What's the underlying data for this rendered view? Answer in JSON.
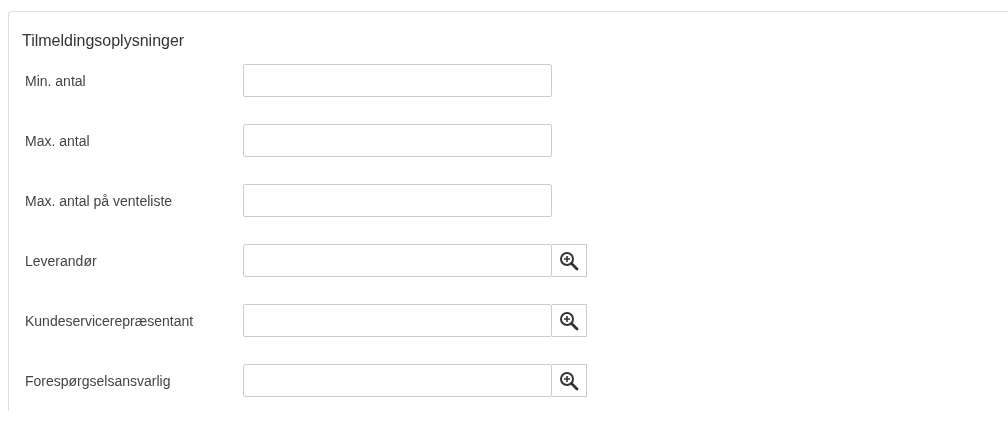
{
  "panel": {
    "title": "Tilmeldingsoplysninger"
  },
  "fields": [
    {
      "label": "Min. antal",
      "kind": "text"
    },
    {
      "label": "Max. antal",
      "kind": "text"
    },
    {
      "label": "Max. antal på venteliste",
      "kind": "text"
    },
    {
      "label": "Leverandør",
      "kind": "lookup"
    },
    {
      "label": "Kundeservicerepræsentant",
      "kind": "lookup"
    },
    {
      "label": "Forespørgselsansvarlig",
      "kind": "lookup"
    }
  ]
}
